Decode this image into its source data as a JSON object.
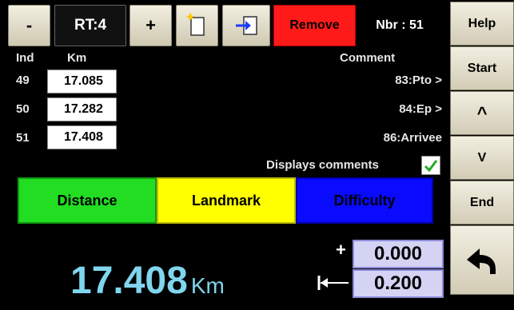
{
  "toolbar": {
    "minus_label": "-",
    "rt_label": "RT:4",
    "plus_label": "+",
    "remove_label": "Remove",
    "nbr_label": "Nbr : 51"
  },
  "sidebar": {
    "help": "Help",
    "start": "Start",
    "up": "^",
    "down": "V",
    "end": "End"
  },
  "table": {
    "headers": {
      "ind": "Ind",
      "km": "Km",
      "comment": "Comment"
    },
    "rows": [
      {
        "ind": "49",
        "km": "17.085",
        "comment": "83:Pto >"
      },
      {
        "ind": "50",
        "km": "17.282",
        "comment": "84:Ep >"
      },
      {
        "ind": "51",
        "km": "17.408",
        "comment": "86:Arrivee"
      }
    ]
  },
  "display_comments": {
    "label": "Displays comments",
    "checked": true
  },
  "tabs": {
    "distance": "Distance",
    "landmark": "Landmark",
    "difficulty": "Difficulty"
  },
  "bottom": {
    "distance_value": "17.408",
    "distance_unit": "Km",
    "plus_sign": "+",
    "plus_value": "0.000",
    "offset_value": "0.200"
  },
  "colors": {
    "remove": "#ff1a1a",
    "distance_tab": "#22dd22",
    "landmark_tab": "#ffff00",
    "difficulty_tab": "#0a0aff",
    "distance_text": "#7fd6ee",
    "value_box": "#d5d3f3"
  }
}
